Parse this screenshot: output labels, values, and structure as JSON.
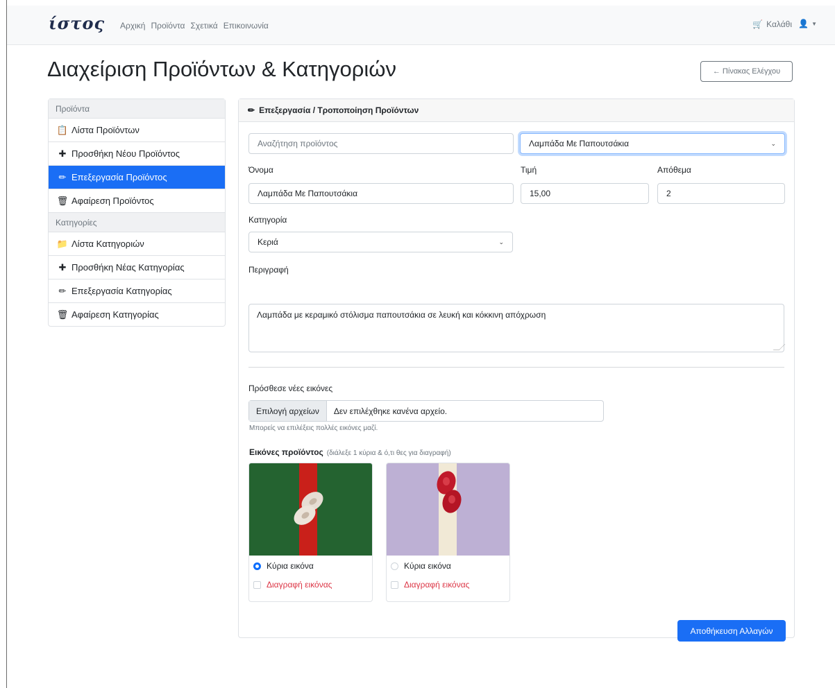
{
  "nav": {
    "brand": "ίστος",
    "links": [
      "Αρχική",
      "Προϊόντα",
      "Σχετικά",
      "Επικοινωνία"
    ],
    "cart_label": "Καλάθι",
    "cart_icon": "cart-icon",
    "user_icon": "user-icon"
  },
  "page": {
    "title": "Διαχείριση Προϊόντων & Κατηγοριών",
    "back_button": "← Πίνακας Ελέγχου"
  },
  "sidebar": {
    "products_header": "Προϊόντα",
    "products_items": [
      {
        "label": "Λίστα Προϊόντων",
        "icon": "clipboard-icon",
        "glyph": "📋"
      },
      {
        "label": "Προσθήκη Νέου Προϊόντος",
        "icon": "plus-icon",
        "glyph": "➕"
      },
      {
        "label": "Επεξεργασία Προϊόντος",
        "icon": "pencil-icon",
        "glyph": "✏",
        "active": true
      },
      {
        "label": "Αφαίρεση Προϊόντος",
        "icon": "trash-icon",
        "glyph": "🗑"
      }
    ],
    "categories_header": "Κατηγορίες",
    "categories_items": [
      {
        "label": "Λίστα Κατηγοριών",
        "icon": "folder-icon",
        "glyph": "📁"
      },
      {
        "label": "Προσθήκη Νέας Κατηγορίας",
        "icon": "plus-icon",
        "glyph": "➕"
      },
      {
        "label": "Επεξεργασία Κατηγορίας",
        "icon": "pencil-icon",
        "glyph": "✏"
      },
      {
        "label": "Αφαίρεση Κατηγορίας",
        "icon": "trash-icon",
        "glyph": "🗑"
      }
    ],
    "active_color": "#1a6ef5"
  },
  "form": {
    "header": "Επεξεργασία / Τροποποίηση Προϊόντων",
    "search_placeholder": "Αναζήτηση προϊόντος",
    "product_select": "Λαμπάδα Με Παπουτσάκια",
    "name_label": "Όνομα",
    "name_value": "Λαμπάδα Με Παπουτσάκια",
    "price_label": "Τιμή",
    "price_value": "15,00",
    "stock_label": "Απόθεμα",
    "stock_value": "2",
    "category_label": "Κατηγορία",
    "category_value": "Κεριά",
    "description_label": "Περιγραφή",
    "description_value": "Λαμπάδα με κεραμικό στόλισμα παπουτσάκια σε λευκή και κόκκινη απόχρωση",
    "add_images_label": "Πρόσθεσε νέες εικόνες",
    "file_button": "Επιλογή αρχείων",
    "file_status": "Δεν επιλέχθηκε κανένα αρχείο.",
    "file_help": "Μπορείς να επιλέξεις πολλές εικόνες μαζί.",
    "images_title": "Εικόνες προϊόντος",
    "images_hint": "(διάλεξε 1 κύρια & ό,τι θες για διαγραφή)",
    "images": [
      {
        "main_label": "Κύρια εικόνα",
        "delete_label": "Διαγραφή εικόνας",
        "is_main": true
      },
      {
        "main_label": "Κύρια εικόνα",
        "delete_label": "Διαγραφή εικόνας",
        "is_main": false
      }
    ],
    "save_button": "Αποθήκευση Αλλαγών"
  }
}
